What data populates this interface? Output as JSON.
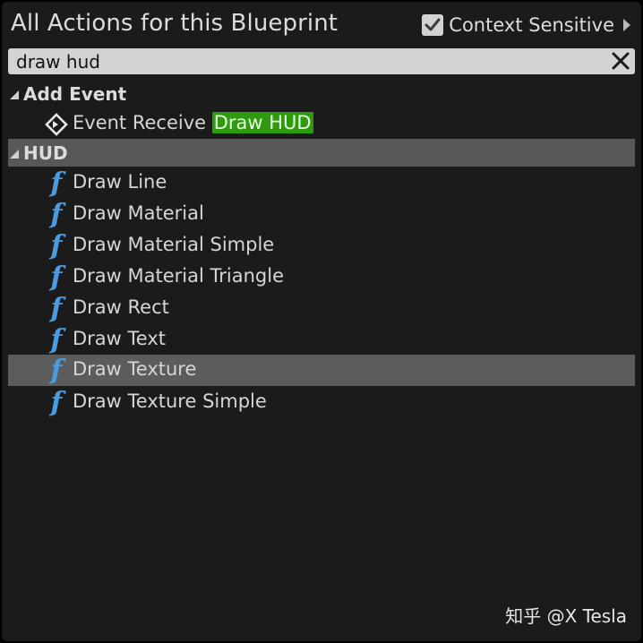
{
  "header": {
    "title": "All Actions for this Blueprint",
    "context_sensitive": {
      "label": "Context Sensitive",
      "checked": true
    }
  },
  "search": {
    "value": "draw hud"
  },
  "categories": [
    {
      "label": "Add Event",
      "items": [
        {
          "prefix": "Event Receive ",
          "highlight": "Draw HUD",
          "icon": "event-node-icon"
        }
      ]
    },
    {
      "label": "HUD",
      "items": [
        {
          "label": "Draw Line",
          "icon": "function-icon"
        },
        {
          "label": "Draw Material",
          "icon": "function-icon"
        },
        {
          "label": "Draw Material Simple",
          "icon": "function-icon"
        },
        {
          "label": "Draw Material Triangle",
          "icon": "function-icon"
        },
        {
          "label": "Draw Rect",
          "icon": "function-icon"
        },
        {
          "label": "Draw Text",
          "icon": "function-icon"
        },
        {
          "label": "Draw Texture",
          "icon": "function-icon",
          "selected": true
        },
        {
          "label": "Draw Texture Simple",
          "icon": "function-icon"
        }
      ]
    }
  ],
  "icons": {
    "function_glyph": "f"
  },
  "colors": {
    "background": "#1b1b1b",
    "function_icon": "#4a9be0",
    "highlight": "#2e9a10",
    "category_bar": "#585858",
    "selected_row": "#5c5c5c"
  },
  "watermark": "知乎 @X Tesla"
}
